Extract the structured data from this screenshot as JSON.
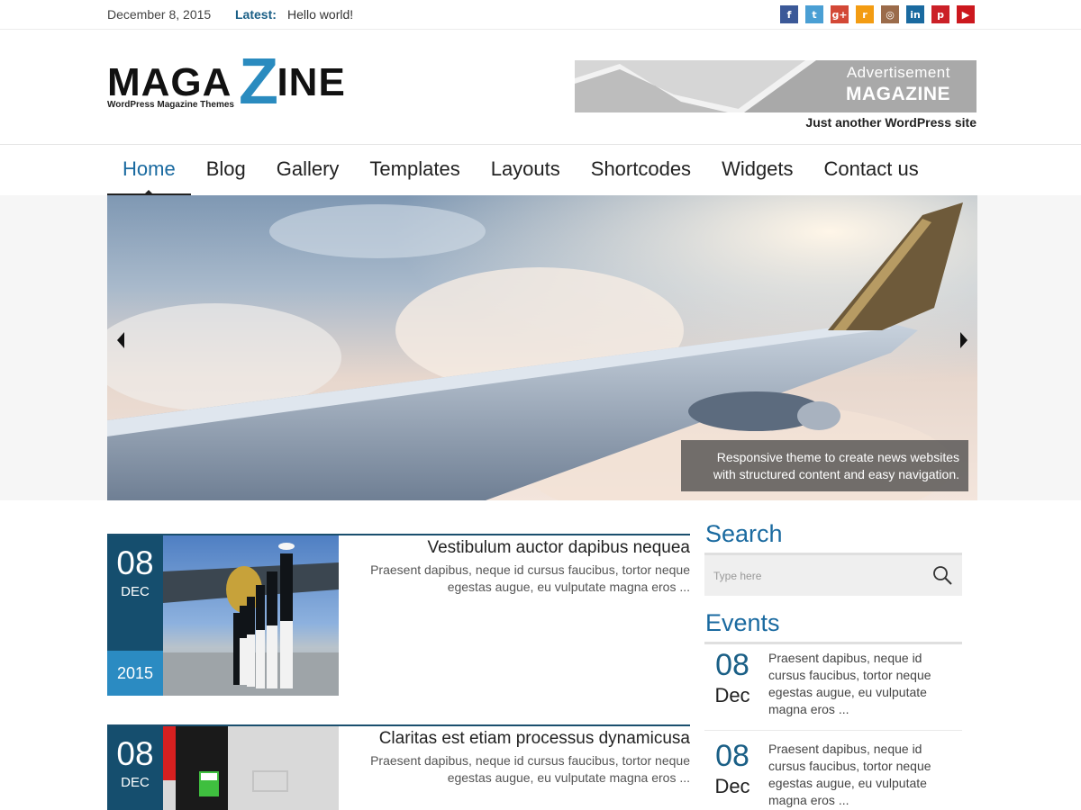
{
  "topbar": {
    "date": "December 8, 2015",
    "latest_label": "Latest:",
    "latest_link": "Hello world!",
    "social": [
      {
        "icon": "facebook-icon",
        "glyph": "f",
        "color": "#3b5998"
      },
      {
        "icon": "twitter-icon",
        "glyph": "t",
        "color": "#4a9fd4"
      },
      {
        "icon": "google-plus-icon",
        "glyph": "g+",
        "color": "#d34836"
      },
      {
        "icon": "rss-icon",
        "glyph": "r",
        "color": "#f39c12"
      },
      {
        "icon": "instagram-icon",
        "glyph": "◎",
        "color": "#9b6b4a"
      },
      {
        "icon": "linkedin-icon",
        "glyph": "in",
        "color": "#1a6aa0"
      },
      {
        "icon": "pinterest-icon",
        "glyph": "p",
        "color": "#cb2027"
      },
      {
        "icon": "youtube-icon",
        "glyph": "▶",
        "color": "#cc181e"
      }
    ]
  },
  "header": {
    "logo_word_left": "MAGA",
    "logo_z": "Z",
    "logo_word_right": "INE",
    "logo_tagline": "WordPress Magazine Themes",
    "ad_text": "Advertisement",
    "ad_logo": "MAGAZINE",
    "site_description": "Just another WordPress site"
  },
  "nav": {
    "items": [
      "Home",
      "Blog",
      "Gallery",
      "Templates",
      "Layouts",
      "Shortcodes",
      "Widgets",
      "Contact us"
    ],
    "active": "Home"
  },
  "slider": {
    "caption_line1": "Responsive theme to create news websites",
    "caption_line2": "with structured content and easy navigation."
  },
  "posts": [
    {
      "day": "08",
      "month": "DEC",
      "year": "2015",
      "title": "Vestibulum auctor dapibus nequea",
      "excerpt": "Praesent dapibus, neque id cursus faucibus, tortor neque egestas augue, eu vulputate magna eros ..."
    },
    {
      "day": "08",
      "month": "DEC",
      "title": "Claritas est etiam processus dynamicusa",
      "excerpt": "Praesent dapibus, neque id cursus faucibus, tortor neque egestas augue, eu vulputate magna eros ..."
    }
  ],
  "sidebar": {
    "search_title": "Search",
    "search_placeholder": "Type here",
    "events_title": "Events",
    "events": [
      {
        "day": "08",
        "month": "Dec",
        "text": "Praesent dapibus, neque id cursus faucibus, tortor neque egestas augue, eu vulputate magna eros ..."
      },
      {
        "day": "08",
        "month": "Dec",
        "text": "Praesent dapibus, neque id cursus faucibus, tortor neque egestas augue, eu vulputate magna eros ..."
      }
    ]
  },
  "colors": {
    "accent": "#1a6aa0",
    "date_box": "#154e6e",
    "year_box": "#2b8bc2"
  }
}
